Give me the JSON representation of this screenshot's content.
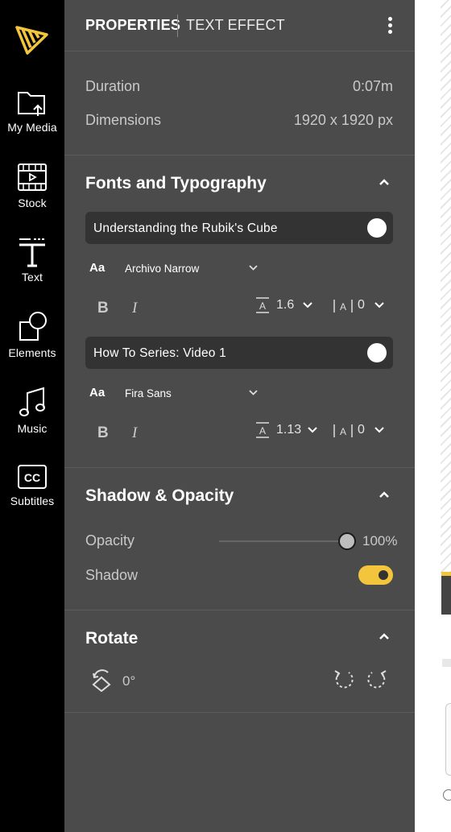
{
  "sidebar": {
    "items": [
      {
        "label": "My Media",
        "icon": "folder-upload-icon"
      },
      {
        "label": "Stock",
        "icon": "film-icon"
      },
      {
        "label": "Text",
        "icon": "text-icon"
      },
      {
        "label": "Elements",
        "icon": "shapes-icon"
      },
      {
        "label": "Music",
        "icon": "music-icon"
      },
      {
        "label": "Subtitles",
        "icon": "cc-icon"
      }
    ]
  },
  "header": {
    "tabs": [
      {
        "label": "PROPERTIES",
        "active": true
      },
      {
        "label": "TEXT EFFECT",
        "active": false
      }
    ]
  },
  "meta": {
    "duration_label": "Duration",
    "duration_value": "0:07m",
    "dimensions_label": "Dimensions",
    "dimensions_value": "1920 x 1920 px"
  },
  "fonts": {
    "title": "Fonts and Typography",
    "entries": [
      {
        "text": "Understanding the Rubik's Cube",
        "aa": "Aa",
        "font": "Archivo Narrow",
        "bold": "B",
        "italic": "I",
        "line_height": "1.6",
        "letter_spacing": "0"
      },
      {
        "text": "How To Series: Video 1",
        "aa": "Aa",
        "font": "Fira Sans",
        "bold": "B",
        "italic": "I",
        "line_height": "1.13",
        "letter_spacing": "0"
      }
    ]
  },
  "shadow": {
    "title": "Shadow & Opacity",
    "opacity_label": "Opacity",
    "opacity_value": "100%",
    "opacity_fraction": 1.0,
    "shadow_label": "Shadow",
    "shadow_on": true
  },
  "rotate": {
    "title": "Rotate",
    "value": "0°"
  },
  "colors": {
    "accent": "#f2c53d",
    "panel": "#4b4b4b",
    "rail": "#000000",
    "row": "#333333"
  }
}
